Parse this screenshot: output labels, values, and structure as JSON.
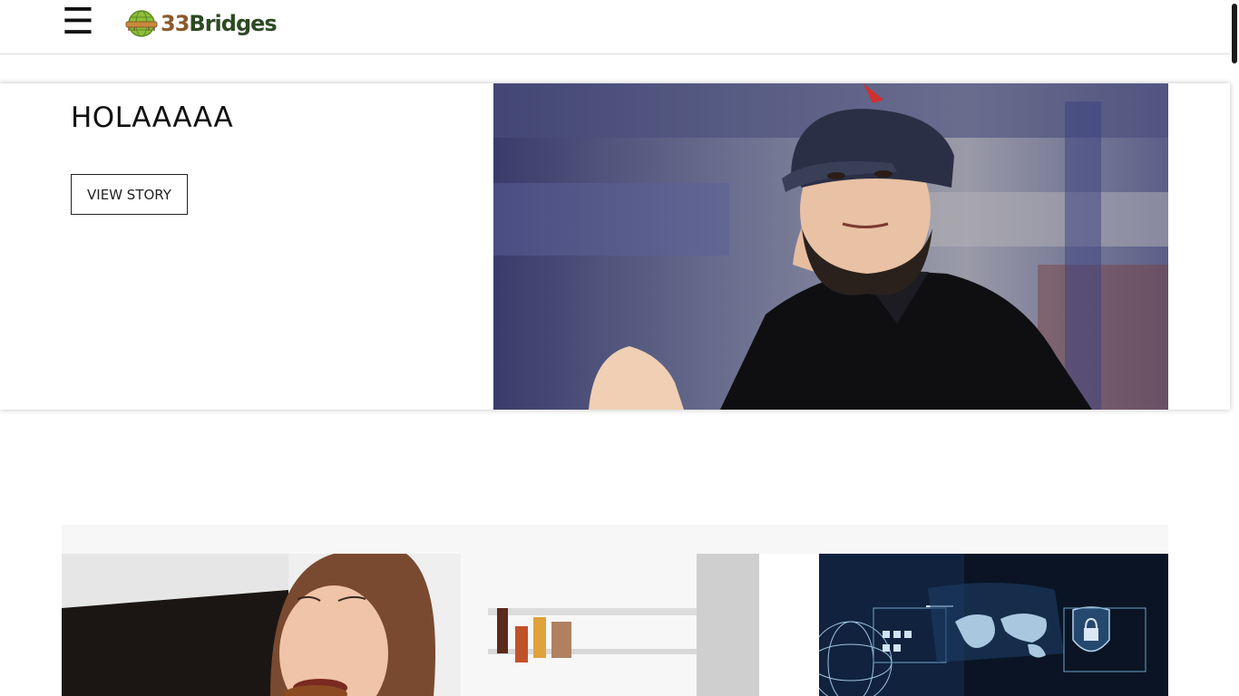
{
  "header": {
    "menu_icon": "hamburger-menu-icon",
    "menu_glyph": "☰",
    "logo": {
      "icon": "globe-icon",
      "text_number": "33",
      "text_word": "Bridges"
    }
  },
  "hero": {
    "title": "HOLAAAAA",
    "button_label": "VIEW STORY",
    "image": "photo of a smiling man in a dark cap and black polo shirt at a stadium"
  },
  "cards": [
    {
      "image": "photo of a woman eating in front of an open refrigerator"
    },
    {
      "image": "dark blue cybersecurity illustration with world map and padlock shield"
    }
  ],
  "colors": {
    "logo_green": "#2d4a23",
    "logo_brown": "#8a5a2e",
    "text": "#111111",
    "band": "#f7f7f7"
  }
}
